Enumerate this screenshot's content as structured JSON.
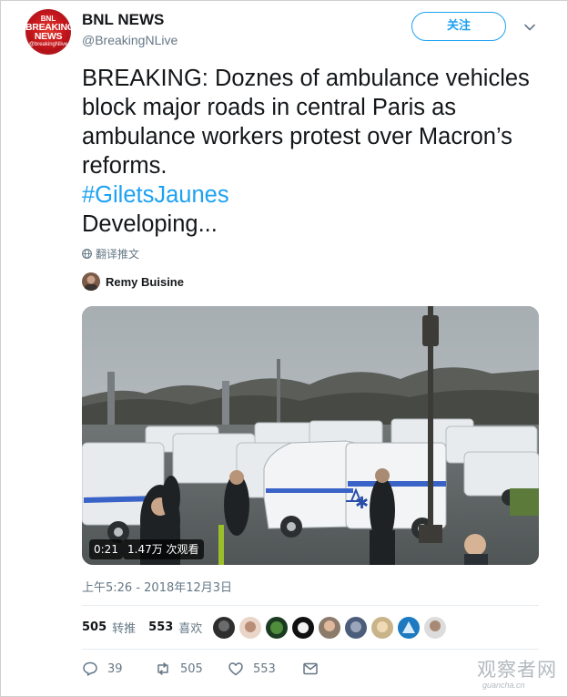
{
  "account": {
    "name": "BNL NEWS",
    "handle": "@BreakingNLive",
    "avatar_text_top": "BNL",
    "avatar_text_main": "BREAKING NEWS",
    "avatar_text_bottom": "@breakingNlive",
    "follow_label": "关注",
    "menu_icon": "chevron-down-icon"
  },
  "tweet": {
    "line1": "BREAKING: Doznes of ambulance vehicles block major roads in central Paris as ambulance workers protest over Macron’s reforms.",
    "hashtag": "#GiletsJaunes",
    "line3": "Developing...",
    "translate_label": "翻译推文"
  },
  "attribution": {
    "name": "Remy Buisine"
  },
  "media": {
    "duration": "0:21",
    "views": "1.47万 次观看"
  },
  "timestamp": "上午5:26 - 2018年12月3日",
  "stats": {
    "retweets_count": "505",
    "retweets_label": "转推",
    "likes_count": "553",
    "likes_label": "喜欢"
  },
  "actions": {
    "replies": "39",
    "retweets": "505",
    "likes": "553"
  },
  "watermark": {
    "main": "观察者网",
    "sub": "guancha.cn"
  },
  "colors": {
    "accent": "#1da1f2",
    "text": "#14171a",
    "muted": "#657786",
    "brand_red": "#c4151c"
  }
}
